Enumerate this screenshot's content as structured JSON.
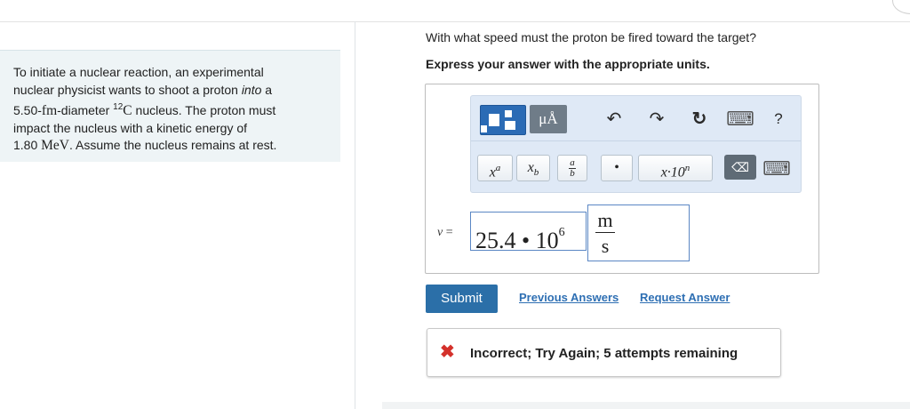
{
  "problem": {
    "line1": "To initiate a nuclear reaction, an experimental",
    "line2a": "nuclear physicist wants to shoot a proton ",
    "line2b": "into",
    "line2c": " a",
    "line3a": "5.50-",
    "line3b": "fm",
    "line3c": "-diameter ",
    "line3d": "12",
    "line3e": "C",
    "line3f": " nucleus. The proton must",
    "line4": "impact the nucleus with a kinetic energy of",
    "line5a": "1.80 ",
    "line5b": "MeV",
    "line5c": ". Assume the nucleus remains at rest."
  },
  "question": "With what speed must the proton be fired toward the target?",
  "instruction": "Express your answer with the appropriate units.",
  "toolbar": {
    "units_button": "μÅ",
    "undo_icon": "↶",
    "redo_icon": "↷",
    "reset_icon": "↻",
    "keyboard_icon": "⌨",
    "help_label": "?",
    "superscript_base": "x",
    "superscript_exp": "a",
    "subscript_base": "x",
    "subscript_sub": "b",
    "fraction_num": "a",
    "fraction_den": "b",
    "dot_label": "•",
    "sci_label": "x·10",
    "sci_exp": "n",
    "delete_label": "⌫"
  },
  "answer": {
    "variable": "v",
    "equals": " =",
    "value": "25.4 • 10",
    "exponent": "6",
    "unit_num": "m",
    "unit_den": "s"
  },
  "actions": {
    "submit": "Submit",
    "previous": "Previous Answers",
    "request": "Request Answer"
  },
  "feedback": {
    "icon": "✖",
    "text": "Incorrect; Try Again; 5 attempts remaining"
  },
  "colors": {
    "accent": "#2b6fa8",
    "error": "#d4312b",
    "link": "#2e6fb3"
  }
}
